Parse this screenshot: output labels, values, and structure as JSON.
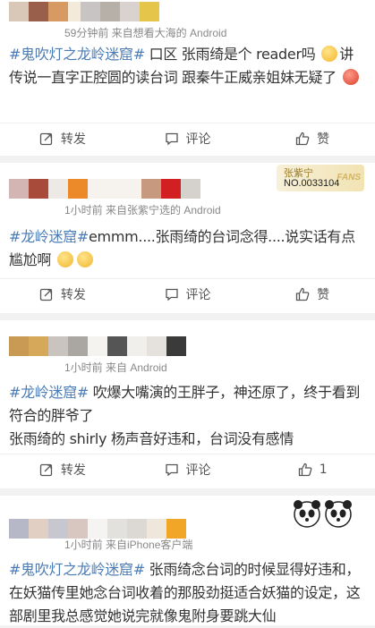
{
  "colors": {
    "link": "#4c7cb5",
    "meta": "#888888",
    "text": "#333333",
    "bg": "#f2f2f2"
  },
  "posts": [
    {
      "meta": "59分钟前 来自想看大海的 Android",
      "tag": "#鬼吹灯之龙岭迷窟#",
      "text": " 口区 张雨绮是个 reader吗 ",
      "text2": "讲传说一直字正腔圆的读台词 跟秦牛正威亲姐妹无疑了",
      "repost": "转发",
      "comment": "评论",
      "like": "赞"
    },
    {
      "meta": "1小时前 来自张紫宁选的 Android",
      "tag": "#龙岭迷窟#",
      "text": "emmm....张雨绮的台词念得....说实话有点尴尬啊",
      "badge": {
        "name": "张紫宁",
        "number": "NO.0033104",
        "fans": "FANS"
      },
      "repost": "转发",
      "comment": "评论",
      "like": "赞"
    },
    {
      "meta": "1小时前 来自 Android",
      "tag": "#龙岭迷窟#",
      "text": " 吹爆大嘴演的王胖子，神还原了，终于看到符合的胖爷了",
      "text2": "张雨绮的 shirly 杨声音好违和，台词没有感情",
      "repost": "转发",
      "comment": "评论",
      "like_count": "1"
    },
    {
      "meta": "1小时前 来自iPhone客户端",
      "tag": "#鬼吹灯之龙岭迷窟#",
      "text": " 张雨绮念台词的时候显得好违和，在妖猫传里她念台词收着的那股劲挺适合妖猫的设定，这部剧里我总感觉她说完就像鬼附身要跳大仙"
    }
  ]
}
